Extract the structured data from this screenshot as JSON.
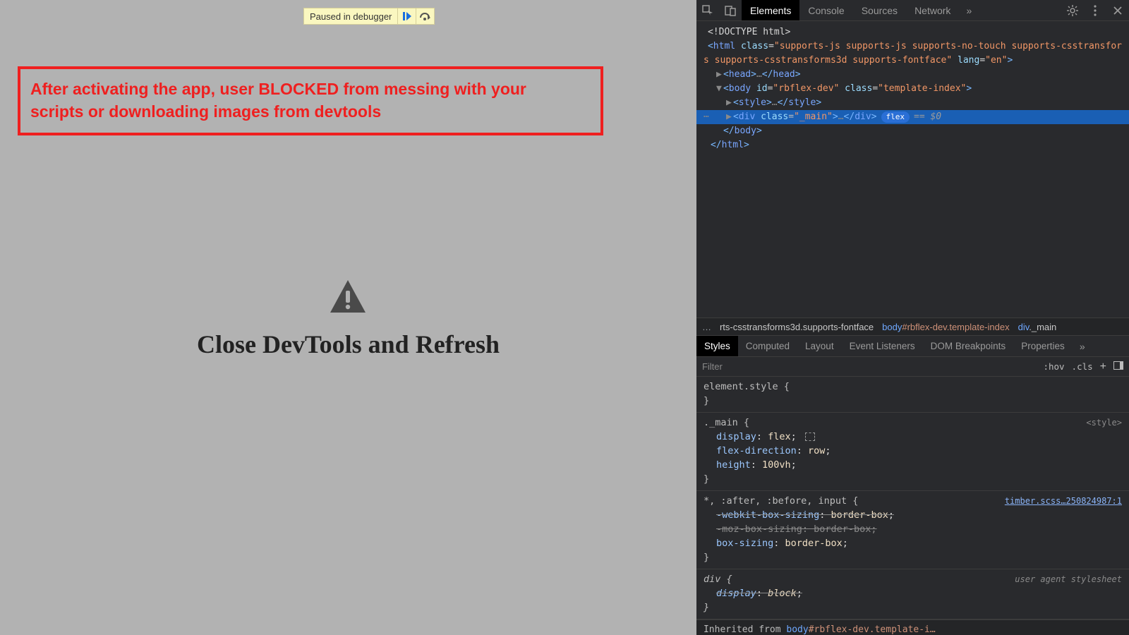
{
  "debugger": {
    "label": "Paused in debugger"
  },
  "annotation": {
    "line1": "After activating the app, user BLOCKED from messing with your",
    "line2": "scripts or downloading images from devtools"
  },
  "page_message": "Close DevTools and Refresh",
  "devtools": {
    "top_tabs": [
      "Elements",
      "Console",
      "Sources",
      "Network"
    ],
    "more_glyph": "»",
    "dom": {
      "doctype": "<!DOCTYPE html>",
      "html_open_prefix": "<html class=\"",
      "html_class_l1": "supports-js supports-js supports-no-touch supports-csstransfor",
      "html_class_l2": "s supports-csstransforms3d supports-fontface",
      "html_lang_attr": "\" lang=\"en\">",
      "head_line": "<head>…</head>",
      "body_open": "<body id=\"rbflex-dev\" class=\"template-index\">",
      "style_line": "<style>…</style>",
      "selected_line": "<div class=\"_main\">…</div>",
      "flex_badge": "flex",
      "eq0": "== $0",
      "body_close": "</body>",
      "html_close": "</html>"
    },
    "breadcrumb": {
      "ellipsis": "…",
      "c1": "rts-csstransforms3d.supports-fontface",
      "c2_tag": "body",
      "c2_rest": "#rbflex-dev.template-index",
      "c3_tag": "div",
      "c3_rest": "._main"
    },
    "styles_tabs": [
      "Styles",
      "Computed",
      "Layout",
      "Event Listeners",
      "DOM Breakpoints",
      "Properties"
    ],
    "filter": {
      "placeholder": "Filter",
      "hov": ":hov",
      "cls": ".cls"
    },
    "rules": {
      "element_style": "element.style {",
      "brace_close": "}",
      "r1_sel": "._main {",
      "r1_src": "<style>",
      "r1_p1n": "display",
      "r1_p1v": "flex",
      "r1_p2n": "flex-direction",
      "r1_p2v": "row",
      "r1_p3n": "height",
      "r1_p3v": "100vh",
      "r2_sel": "*, :after, :before, input {",
      "r2_src": "timber.scss…250824987:1",
      "r2_p1n": "-webkit-box-sizing",
      "r2_p1v": "border-box",
      "r2_p2": "-moz-box-sizing: border-box;",
      "r2_p3n": "box-sizing",
      "r2_p3v": "border-box",
      "r3_sel": "div {",
      "r3_src": "user agent stylesheet",
      "r3_p1n": "display",
      "r3_p1v": "block",
      "inherit_label": "Inherited from ",
      "inherit_tag": "body",
      "inherit_rest": "#rbflex-dev.template-i…"
    }
  }
}
